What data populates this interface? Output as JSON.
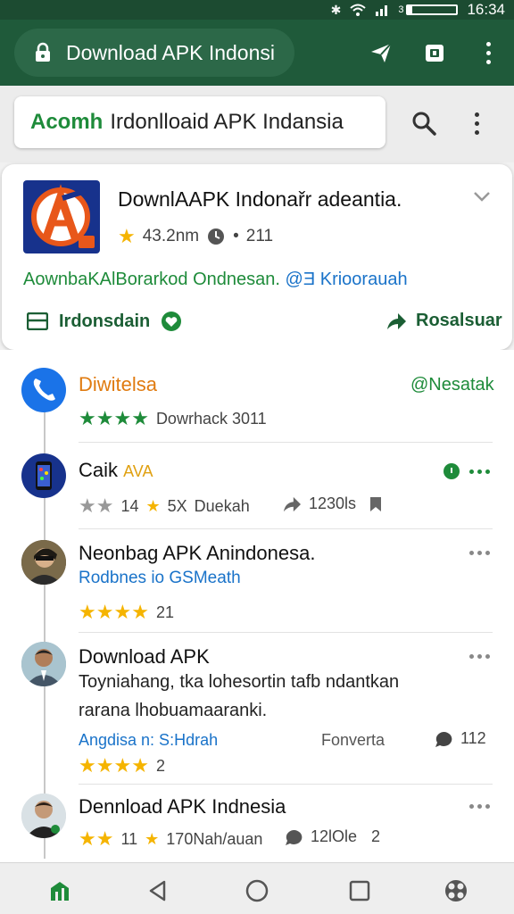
{
  "status_bar": {
    "time": "16:34",
    "battery_label": "3",
    "battery_fraction": 0.08
  },
  "browser": {
    "url_title": "Download APK Indonsi"
  },
  "search": {
    "prefix": "Acomh",
    "text": "Irdonlloaid APK Indansia"
  },
  "featured": {
    "title": "DownlAAPK Indonařr adeantia.",
    "rating": "43.2nm",
    "meta_extra": "211",
    "desc_green": "AownbaKAlBorarkod Ondnesan.",
    "desc_blue": "@Ǝ Krioorauah",
    "left_action": "Irdonsdain",
    "right_action": "Rosalsuar"
  },
  "feed": [
    {
      "title": "Diwitelsa",
      "tag": "@Nesatak",
      "subtitle": "Dowrhack 3011",
      "stars": 4
    },
    {
      "title": "Caik",
      "title_badge": "AVA",
      "stars_text": "14",
      "count": "5X",
      "source": "Duekah",
      "shares": "1230ls",
      "stars": 2
    },
    {
      "title": "Neonbag APK Anindonesa.",
      "link": "Rodbnes io GSMeath",
      "stars": 4,
      "count": "21"
    },
    {
      "title": "Download APK",
      "body_line1": "Toyniahang, tka lohesortin tafb ndantkan",
      "body_line2": "rarana lhobuamaaranki.",
      "link": "Angdisa n: S:Hdrah",
      "tag": "Fonverta",
      "comments": "112",
      "stars": 4,
      "count": "2"
    },
    {
      "title": "Dennload APK Indnesia",
      "stars_text": "11",
      "count": "170Nah/auan",
      "comments": "12lOle",
      "extra": "2",
      "stars": 2
    }
  ],
  "colors": {
    "app_bar": "#1f5a3a",
    "status_bar": "#1c4b31",
    "accent_green": "#1e8b3a",
    "link_blue": "#1a73c9",
    "star": "#f5b400"
  },
  "icons": [
    "lock-icon",
    "send-icon",
    "tab-switch-icon",
    "more-vert-icon",
    "search-icon",
    "chevron-down-icon",
    "bookmark-box-icon",
    "check-heart-icon",
    "share-arrow-icon",
    "phone-icon",
    "comment-icon",
    "home-icon",
    "back-icon",
    "circle-home-icon",
    "square-recents-icon",
    "app-switcher-icon"
  ]
}
